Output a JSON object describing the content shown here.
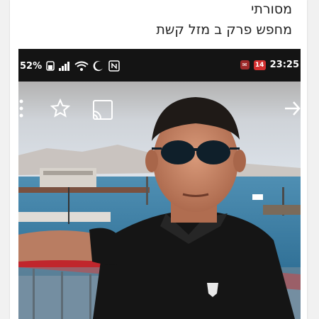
{
  "post": {
    "line1": "מסורתי",
    "line2": "מחפש פרק ב  מזל קשת"
  },
  "status_bar": {
    "battery": "52%",
    "time": "23:25",
    "notif_badge": "14"
  },
  "icons": {
    "menu": "more-vertical-icon",
    "star": "star-outline-icon",
    "cast": "cast-icon",
    "forward": "arrow-right-icon",
    "signal": "signal-bars-icon",
    "wifi": "wifi-icon",
    "moon": "moon-icon",
    "nfc": "nfc-icon"
  },
  "colors": {
    "status_bg": "#141414",
    "badge": "#d32f2f",
    "railing": "#c0262c",
    "shirt": "#151515"
  }
}
